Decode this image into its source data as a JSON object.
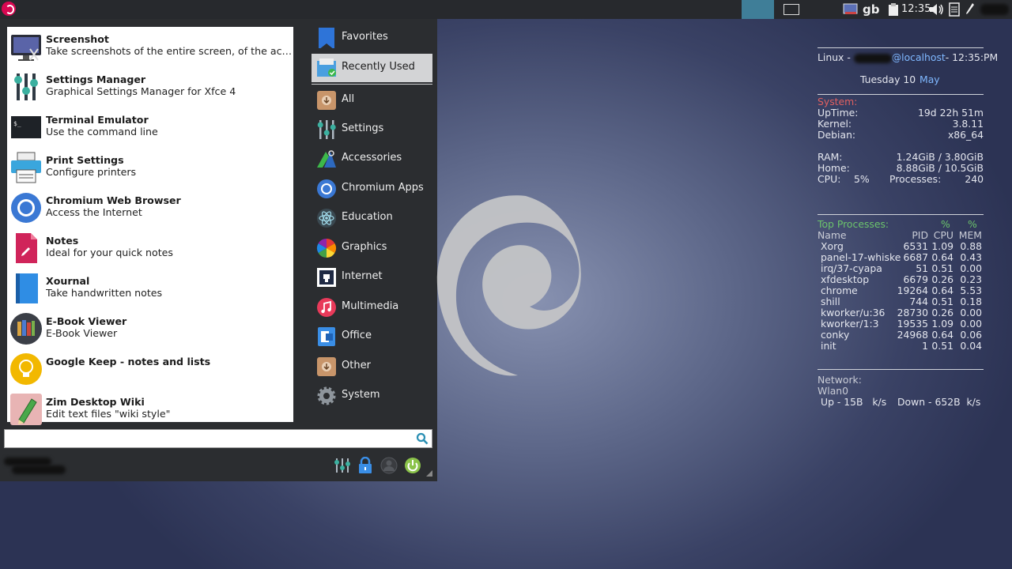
{
  "panel": {
    "keyboard_layout": "gb",
    "clock": "12:35"
  },
  "favorites": [
    {
      "name": "Screenshot",
      "desc": "Take screenshots of the entire screen, of the acti..."
    },
    {
      "name": "Settings Manager",
      "desc": "Graphical Settings Manager for Xfce 4"
    },
    {
      "name": "Terminal Emulator",
      "desc": "Use the command line"
    },
    {
      "name": "Print Settings",
      "desc": "Configure printers"
    },
    {
      "name": "Chromium Web Browser",
      "desc": "Access the Internet"
    },
    {
      "name": "Notes",
      "desc": "Ideal for your quick notes"
    },
    {
      "name": "Xournal",
      "desc": "Take handwritten notes"
    },
    {
      "name": "E-Book Viewer",
      "desc": "E-Book Viewer"
    },
    {
      "name": "Google Keep - notes and lists",
      "desc": ""
    },
    {
      "name": "Zim Desktop Wiki",
      "desc": "Edit text files \"wiki style\""
    }
  ],
  "categories": [
    {
      "label": "Favorites",
      "icon": "bookmark-icon"
    },
    {
      "label": "Recently Used",
      "icon": "recent-folder-icon"
    },
    {
      "label": "All",
      "icon": "all-apps-icon"
    },
    {
      "label": "Settings",
      "icon": "settings-sliders-icon"
    },
    {
      "label": "Accessories",
      "icon": "accessories-icon"
    },
    {
      "label": "Chromium Apps",
      "icon": "chromium-icon"
    },
    {
      "label": "Education",
      "icon": "atom-icon"
    },
    {
      "label": "Graphics",
      "icon": "color-wheel-icon"
    },
    {
      "label": "Internet",
      "icon": "network-icon"
    },
    {
      "label": "Multimedia",
      "icon": "music-note-icon"
    },
    {
      "label": "Office",
      "icon": "office-icon"
    },
    {
      "label": "Other",
      "icon": "other-apps-icon"
    },
    {
      "label": "System",
      "icon": "gear-icon"
    }
  ],
  "search": {
    "value": ""
  },
  "conky": {
    "header_prefix": "Linux -",
    "header_host": "@localhost",
    "header_time": "- 12:35:PM",
    "date_day": "Tuesday 10",
    "date_month": "May",
    "system_title": "System:",
    "system_rows": [
      {
        "label": "UpTime:",
        "value": "19d 22h 51m"
      },
      {
        "label": "Kernel:",
        "value": "3.8.11"
      },
      {
        "label": "Debian:",
        "value": "x86_64"
      }
    ],
    "ram_label": "RAM:",
    "ram_value": "1.24GiB / 3.80GiB",
    "home_label": "Home:",
    "home_value": "8.88GiB / 10.5GiB",
    "cpu_label": "CPU:",
    "cpu_value": "5%",
    "proc_label": "Processes:",
    "proc_value": "240",
    "top_title": "Top Processes:",
    "top_pct1": "%",
    "top_pct2": "%",
    "top_headers": {
      "name": "Name",
      "pid": "PID",
      "cpu": "CPU",
      "mem": "MEM"
    },
    "processes": [
      {
        "name": "Xorg",
        "pid": "6531",
        "cpu": "1.09",
        "mem": "0.88"
      },
      {
        "name": "panel-17-whiske",
        "pid": "6687",
        "cpu": "0.64",
        "mem": "0.43"
      },
      {
        "name": "irq/37-cyapa",
        "pid": "51",
        "cpu": "0.51",
        "mem": "0.00"
      },
      {
        "name": "xfdesktop",
        "pid": "6679",
        "cpu": "0.26",
        "mem": "0.23"
      },
      {
        "name": "chrome",
        "pid": "19264",
        "cpu": "0.64",
        "mem": "5.53"
      },
      {
        "name": "shill",
        "pid": "744",
        "cpu": "0.51",
        "mem": "0.18"
      },
      {
        "name": "kworker/u:36",
        "pid": "28730",
        "cpu": "0.26",
        "mem": "0.00"
      },
      {
        "name": "kworker/1:3",
        "pid": "19535",
        "cpu": "1.09",
        "mem": "0.00"
      },
      {
        "name": "conky",
        "pid": "24968",
        "cpu": "0.64",
        "mem": "0.06"
      },
      {
        "name": "init",
        "pid": "1",
        "cpu": "0.51",
        "mem": "0.04"
      }
    ],
    "network_title": "Network:",
    "network_iface": "Wlan0",
    "net_up": "Up - 15B   k/s",
    "net_down": "Down - 652B  k/s"
  }
}
